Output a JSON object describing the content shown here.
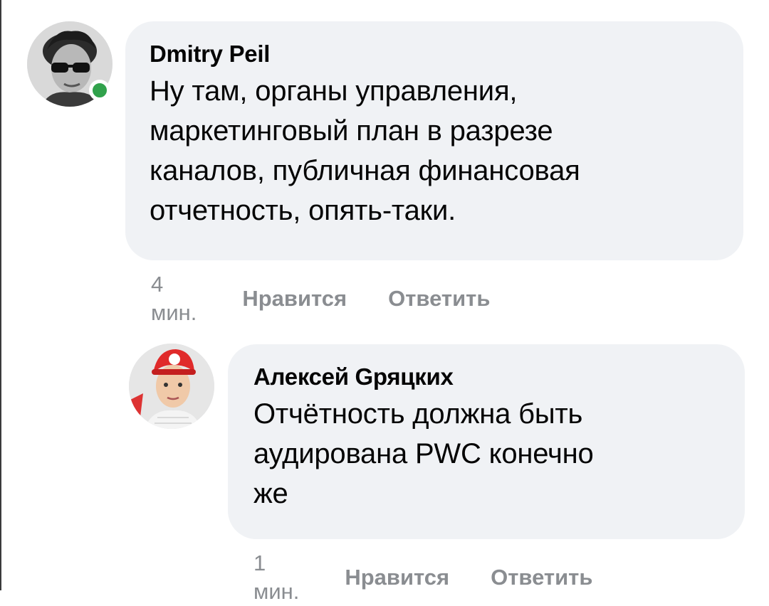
{
  "comments": [
    {
      "author": "Dmitry Peil",
      "text_lines": [
        "Ну там, органы управления,",
        "маркетинговый план в разрезе",
        "каналов, публичная финансовая",
        "отчетность, опять-таки."
      ],
      "time": "4 мин.",
      "like_label": "Нравится",
      "reply_label": "Ответить",
      "online": true
    },
    {
      "author": "Алексей Gряцких",
      "text_lines": [
        "Отчётность должна быть",
        "аудирована PWC конечно",
        "же"
      ],
      "time": "1 мин.",
      "like_label": "Нравится",
      "reply_label": "Ответить",
      "online": false
    }
  ],
  "colors": {
    "bubble": "#f0f2f5",
    "text": "#050505",
    "meta": "#8a8d91",
    "online": "#31a24c"
  }
}
